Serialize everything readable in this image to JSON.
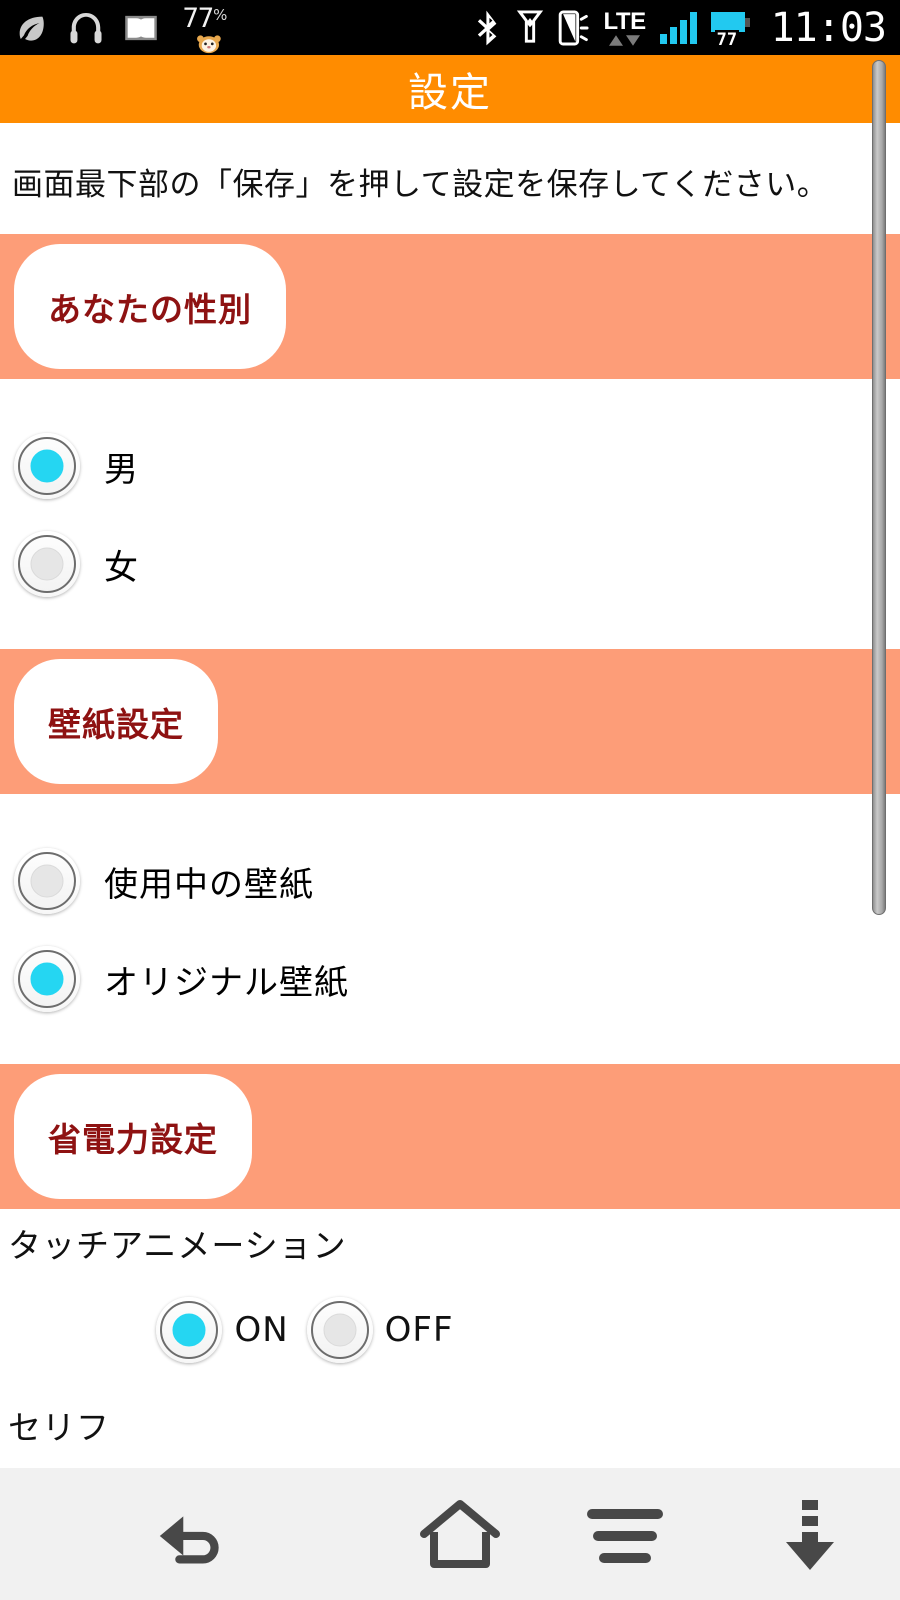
{
  "statusbar": {
    "left_icons": [
      "eco-leaf-icon",
      "headphones-icon",
      "dolby-icon"
    ],
    "battery_percent_text": "77",
    "battery_percent_symbol": "%",
    "mascot_icon": "hamster-mascot-icon",
    "right_icons": [
      "bluetooth-icon",
      "flashlight-icon",
      "vibrate-icon"
    ],
    "network_type": "LTE",
    "signal_bars": 4,
    "battery_level_text": "77",
    "clock": "11:03",
    "accent_color": "#22c9f0",
    "background_color": "#000000"
  },
  "appbar": {
    "title": "設定",
    "background_color": "#ff8c00",
    "text_color": "#ffffff"
  },
  "content": {
    "intro_text": "画面最下部の「保存」を押して設定を保存してください。",
    "band_color": "#fd9d78",
    "pill_text_color": "#8e1212",
    "selected_color": "#25d6f2",
    "sections": [
      {
        "header": "あなたの性別",
        "options": [
          {
            "label": "男",
            "selected": true
          },
          {
            "label": "女",
            "selected": false
          }
        ]
      },
      {
        "header": "壁紙設定",
        "options": [
          {
            "label": "使用中の壁紙",
            "selected": false
          },
          {
            "label": "オリジナル壁紙",
            "selected": true
          }
        ]
      },
      {
        "header": "省電力設定",
        "settings": [
          {
            "name": "タッチアニメーション",
            "choices": [
              {
                "label": "ON",
                "selected": true
              },
              {
                "label": "OFF",
                "selected": false
              }
            ]
          },
          {
            "name": "セリフ",
            "choices": [
              {
                "label": "",
                "selected": false
              },
              {
                "label": "",
                "selected": false
              }
            ]
          }
        ]
      }
    ]
  },
  "navbar": {
    "background_color": "#f1f1f1",
    "buttons": [
      {
        "name": "back",
        "icon": "back-arrow-icon"
      },
      {
        "name": "home",
        "icon": "home-icon"
      },
      {
        "name": "menu",
        "icon": "menu-lines-icon"
      },
      {
        "name": "download",
        "icon": "download-arrow-icon"
      }
    ]
  }
}
